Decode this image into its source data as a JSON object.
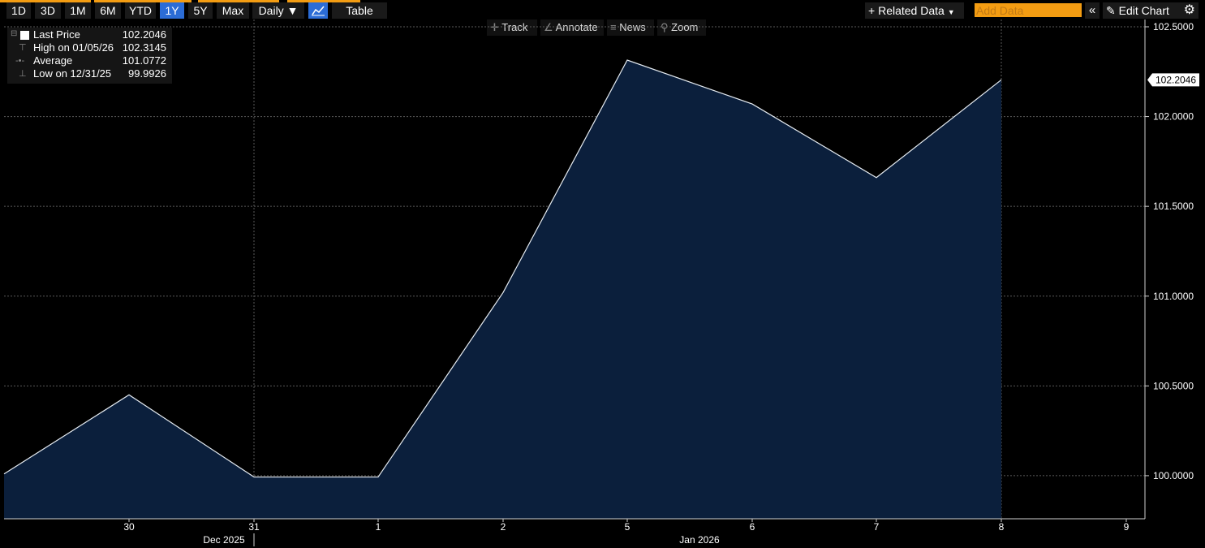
{
  "toolbar": {
    "ranges": [
      "1D",
      "3D",
      "1M",
      "6M",
      "YTD",
      "1Y",
      "5Y",
      "Max"
    ],
    "active_range": "1Y",
    "frequency_label": "Daily",
    "table_label": "Table",
    "related_label": "Related Data",
    "add_data_placeholder": "Add Data",
    "edit_chart_label": "Edit Chart"
  },
  "chart_tools": {
    "track_label": "Track",
    "annotate_label": "Annotate",
    "news_label": "News",
    "zoom_label": "Zoom"
  },
  "legend": {
    "last_price_label": "Last Price",
    "last_price_value": "102.2046",
    "high_label": "High on 01/05/26",
    "high_value": "102.3145",
    "average_label": "Average",
    "average_value": "101.0772",
    "low_label": "Low on 12/31/25",
    "low_value": "99.9926"
  },
  "colors": {
    "accent": "#f39c12",
    "active_button": "#2b6cd6",
    "area_fill": "#0b1f3c",
    "line": "#e6ecf2",
    "grid": "#5a5a5a"
  },
  "chart_data": {
    "type": "area",
    "x": [
      "2025-12-29",
      "2025-12-30",
      "2025-12-31",
      "2026-01-01",
      "2026-01-02",
      "2026-01-05",
      "2026-01-06",
      "2026-01-07",
      "2026-01-08"
    ],
    "values": [
      100.01,
      100.45,
      99.9926,
      99.9926,
      101.02,
      102.3145,
      102.07,
      101.66,
      102.2046
    ],
    "x_tick_labels": [
      "30",
      "31",
      "1",
      "2",
      "5",
      "6",
      "7",
      "8",
      "9"
    ],
    "x_group_labels": [
      "Dec 2025",
      "Jan 2026"
    ],
    "y_ticks": [
      "100.0000",
      "100.5000",
      "101.0000",
      "101.5000",
      "102.0000",
      "102.5000"
    ],
    "ylim": [
      99.76,
      102.5
    ],
    "last_value_label": "102.2046",
    "grid": true,
    "legend_position": "top-left"
  }
}
